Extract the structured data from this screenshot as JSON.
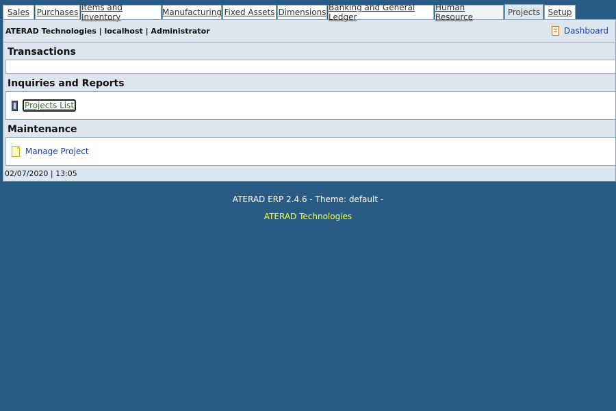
{
  "tabs": [
    {
      "label": "Sales",
      "state": "normal"
    },
    {
      "label": "Purchases",
      "state": "normal"
    },
    {
      "label": "Items and Inventory",
      "state": "normal"
    },
    {
      "label": "Manufacturing",
      "state": "normal"
    },
    {
      "label": "Fixed Assets",
      "state": "normal"
    },
    {
      "label": "Dimensions",
      "state": "normal"
    },
    {
      "label": "Banking and General Ledger",
      "state": "normal"
    },
    {
      "label": "Human Resource",
      "state": "hover"
    },
    {
      "label": "Projects",
      "state": "active"
    },
    {
      "label": "Setup",
      "state": "normal"
    }
  ],
  "header": {
    "company_info": "ATERAD Technologies | localhost | Administrator",
    "dashboard_label": "Dashboard"
  },
  "sections": {
    "transactions": {
      "title": "Transactions"
    },
    "inquiries": {
      "title": "Inquiries and Reports",
      "link": "Projects List"
    },
    "maintenance": {
      "title": "Maintenance",
      "link": "Manage Project"
    }
  },
  "footer": {
    "datetime": "02/07/2020 | 13:05"
  },
  "meta": {
    "version": "ATERAD ERP 2.4.6 - Theme: default -",
    "vendor": "ATERAD Technologies"
  },
  "colors": {
    "background": "#285c85",
    "panel": "#dde6ee",
    "link": "#1a3fa0",
    "vendor_text": "#ffff33"
  },
  "icons": {
    "dashboard": "report-icon",
    "projects_list": "report-icon",
    "manage_project": "document-icon"
  }
}
